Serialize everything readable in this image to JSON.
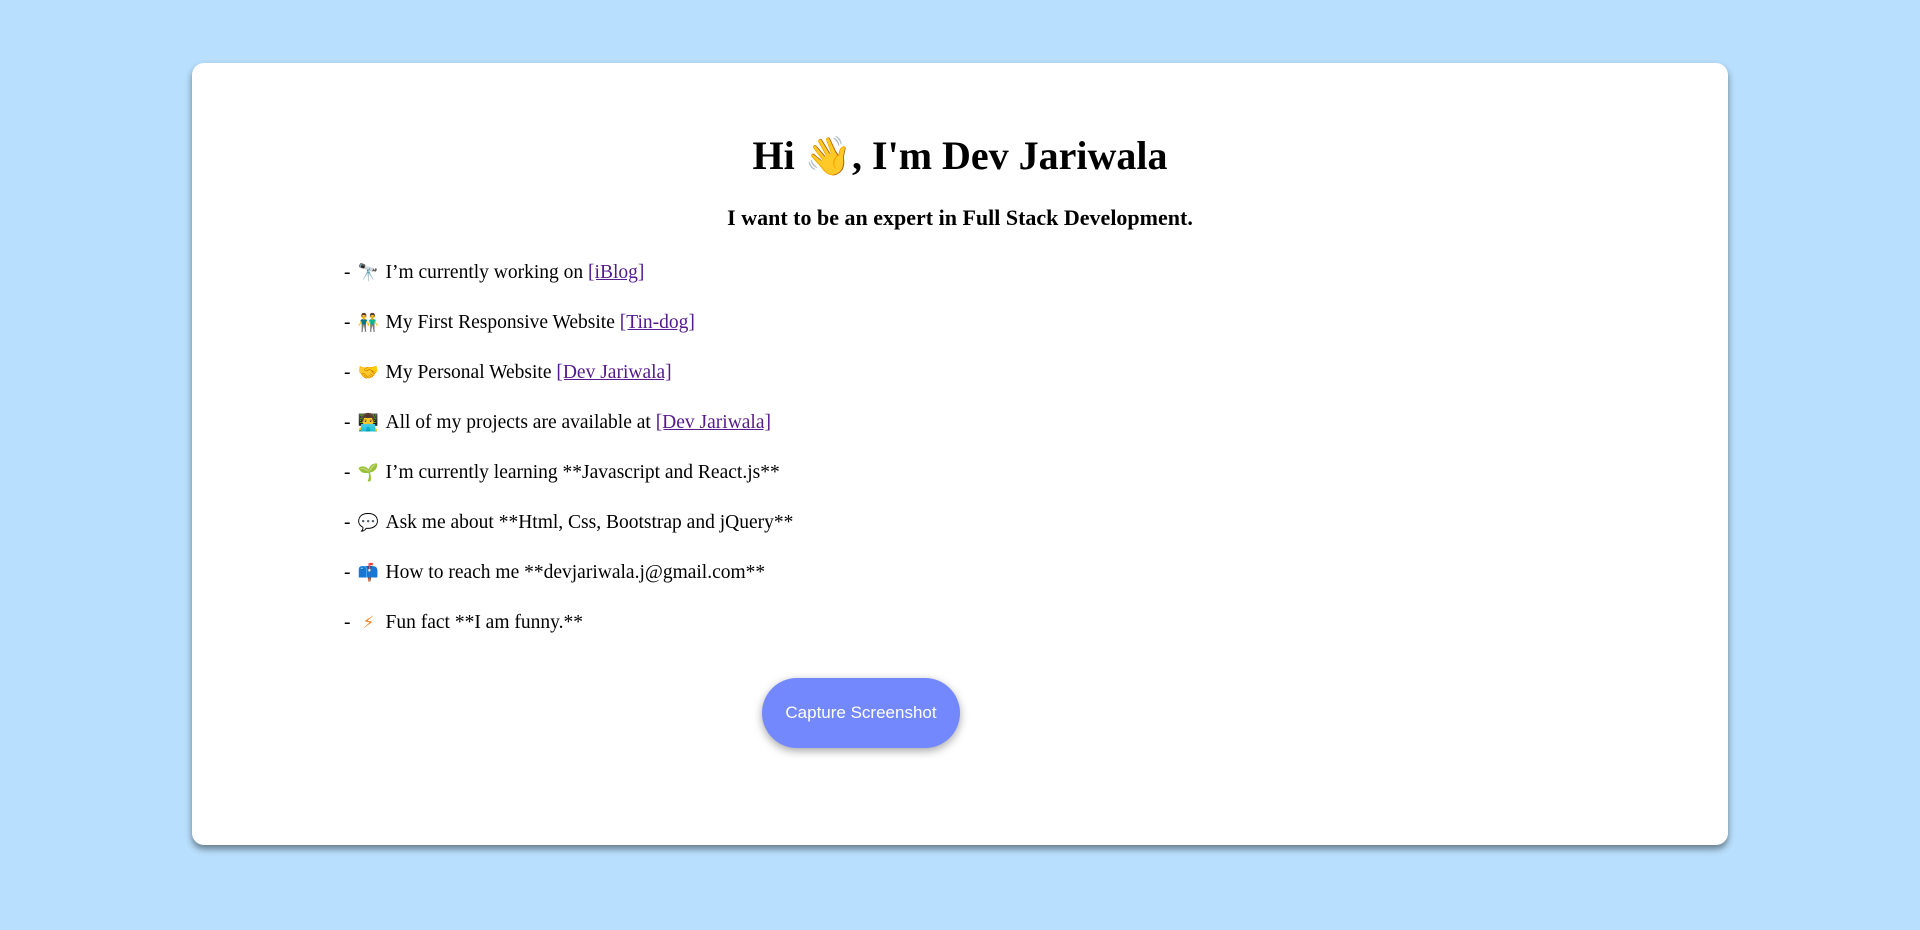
{
  "header": {
    "title_prefix": "Hi ",
    "wave_emoji": "👋",
    "title_suffix": ", I'm Dev Jariwala",
    "subtitle": "I want to be an expert in Full Stack Development."
  },
  "items": [
    {
      "dash": "-",
      "emoji": "🔭",
      "text": "I’m currently working on ",
      "link": "[iBlog]"
    },
    {
      "dash": "-",
      "emoji": "👬",
      "text": "My First Responsive Website ",
      "link": "[Tin-dog]"
    },
    {
      "dash": "-",
      "emoji": "🤝",
      "text": "My Personal Website ",
      "link": "[Dev Jariwala]"
    },
    {
      "dash": "-",
      "emoji": "👨‍💻",
      "text": "All of my projects are available at ",
      "link": "[Dev Jariwala]"
    },
    {
      "dash": "-",
      "emoji": "🌱",
      "text": "I’m currently learning **Javascript and React.js**"
    },
    {
      "dash": "-",
      "emoji": "💬",
      "text": "Ask me about **Html, Css, Bootstrap and jQuery**"
    },
    {
      "dash": "-",
      "emoji": "📫",
      "text": "How to reach me **devjariwala.j@gmail.com**"
    },
    {
      "dash": "-",
      "emoji": "⚡",
      "text": "Fun fact **I am funny.**"
    }
  ],
  "capture_button": {
    "label": "Capture Screenshot"
  },
  "colors": {
    "background": "#b8dffd",
    "card": "#ffffff",
    "button": "#7388fc",
    "link": "#551a8b"
  }
}
